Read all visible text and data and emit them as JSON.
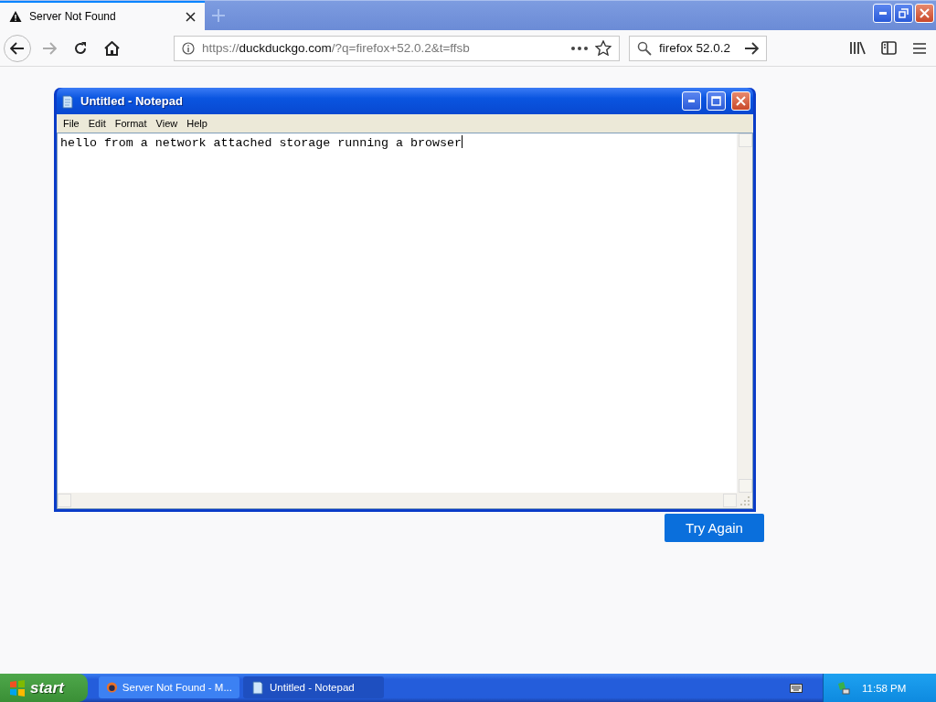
{
  "browser": {
    "tabs": [
      {
        "title": "Server Not Found",
        "selected": true
      }
    ],
    "url": "https://**duckduckgo.com**/?q=firefox+52.0.2&t=ffsb",
    "search": {
      "value": "firefox 52.0.2"
    },
    "page": {
      "button": "Try Again"
    }
  },
  "notepad": {
    "title": "Untitled - Notepad",
    "menu": [
      "File",
      "Edit",
      "Format",
      "View",
      "Help"
    ],
    "text": "hello from a network attached storage running a browser"
  },
  "taskbar": {
    "start": "start",
    "tasks": [
      {
        "label": "Server Not Found - M...",
        "kind": "browser",
        "selected": false
      },
      {
        "label": "Untitled - Notepad",
        "kind": "notepad",
        "selected": true
      }
    ],
    "clock": "11:58 PM"
  }
}
